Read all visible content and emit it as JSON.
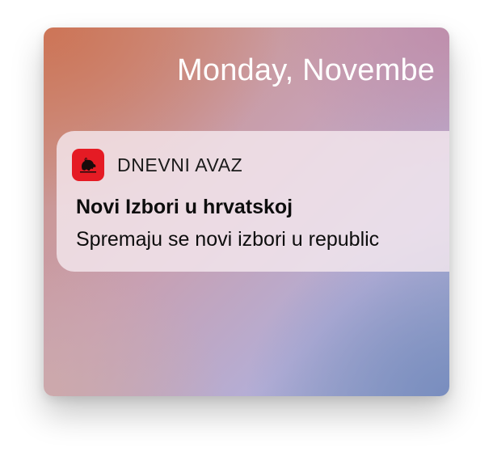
{
  "lock_screen": {
    "date": "Monday, Novembe"
  },
  "notification": {
    "app_icon": "dnevni-avaz-logo-icon",
    "app_icon_color": "#e51b24",
    "app_name": "DNEVNI AVAZ",
    "title": "Novi Izbori u hrvatskoj",
    "body": "Spremaju se novi izbori u republic"
  }
}
